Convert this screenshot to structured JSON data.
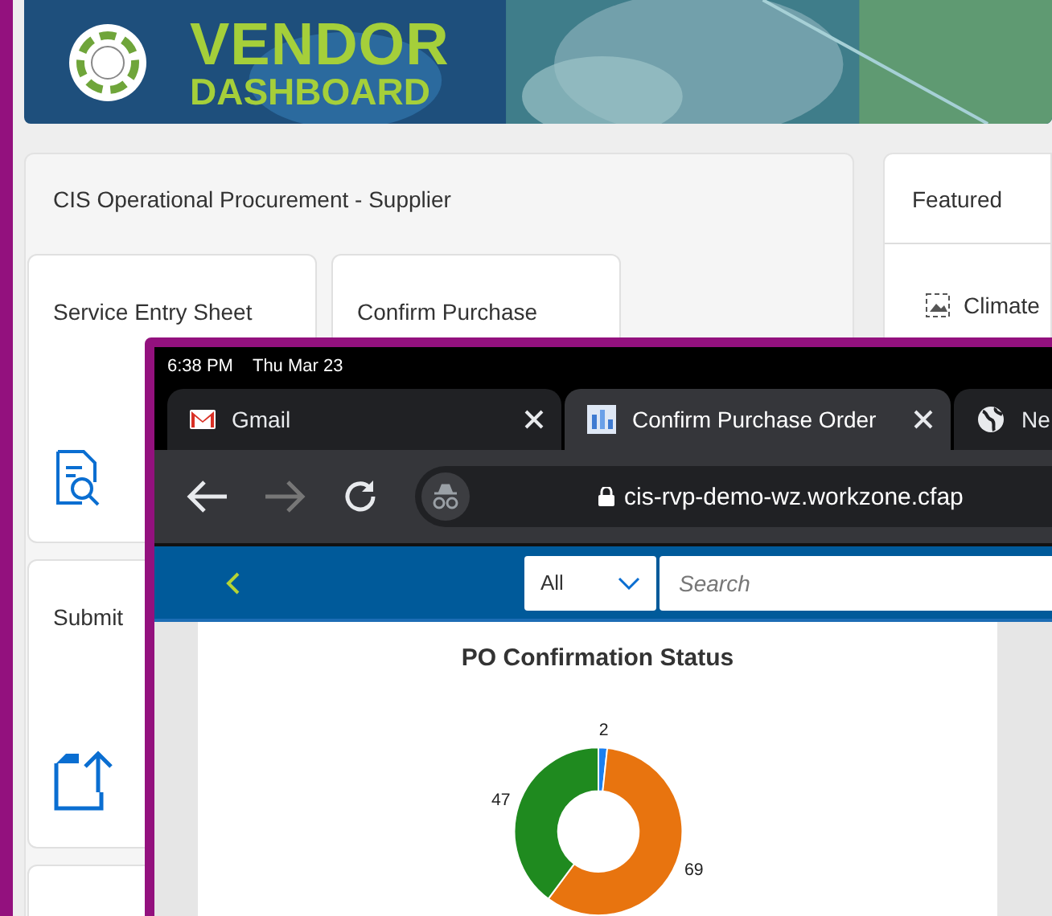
{
  "banner": {
    "title": "VENDOR",
    "subtitle": "DASHBOARD"
  },
  "group": {
    "title": "CIS Operational Procurement - Supplier",
    "tiles": [
      {
        "title": "Service Entry Sheet",
        "kind": "search"
      },
      {
        "title": "Confirm Purchase",
        "kind": "none"
      },
      {
        "title": "Submit",
        "kind": "upload"
      },
      {
        "kind": "none"
      }
    ]
  },
  "featured": {
    "title": "Featured",
    "items": [
      {
        "label": "Climate"
      }
    ]
  },
  "tablet": {
    "time": "6:38 PM",
    "date": "Thu Mar 23",
    "tabs": [
      {
        "label": "Gmail",
        "kind": "mail",
        "selected": false
      },
      {
        "label": "Confirm Purchase Order",
        "kind": "page",
        "selected": true
      },
      {
        "label": "Ne",
        "kind": "globe",
        "selected": false
      }
    ],
    "url": "cis-rvp-demo-wz.workzone.cfap",
    "forward_disabled": true,
    "scope": "All",
    "search_placeholder": "Search",
    "card": {
      "title": "PO Confirmation Status",
      "chart_data": {
        "type": "donut",
        "data_labels": true,
        "values": [
          2,
          69,
          47
        ]
      }
    }
  }
}
